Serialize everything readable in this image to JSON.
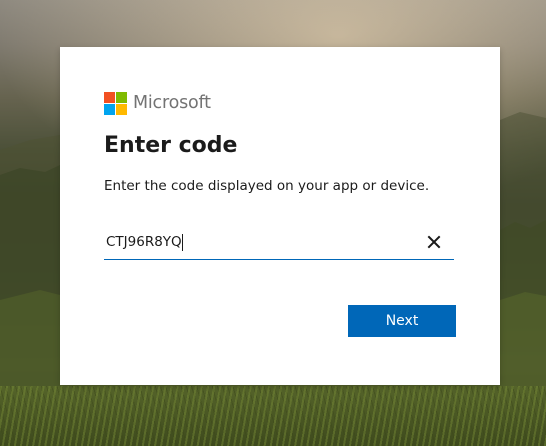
{
  "brand": {
    "name": "Microsoft",
    "logo_colors": {
      "red": "#f25022",
      "green": "#7fba00",
      "blue": "#00a4ef",
      "yellow": "#ffb900"
    }
  },
  "dialog": {
    "title": "Enter code",
    "instructions": "Enter the code displayed on your app or device.",
    "code_input": {
      "value": "CTJ96R8YQ",
      "clear_icon": "close-icon"
    },
    "next_button": {
      "label": "Next",
      "color": "#0067b8"
    }
  },
  "colors": {
    "accent": "#0067b8",
    "text": "#1b1b1b",
    "brand_text": "#737373",
    "card_background": "#ffffff"
  }
}
